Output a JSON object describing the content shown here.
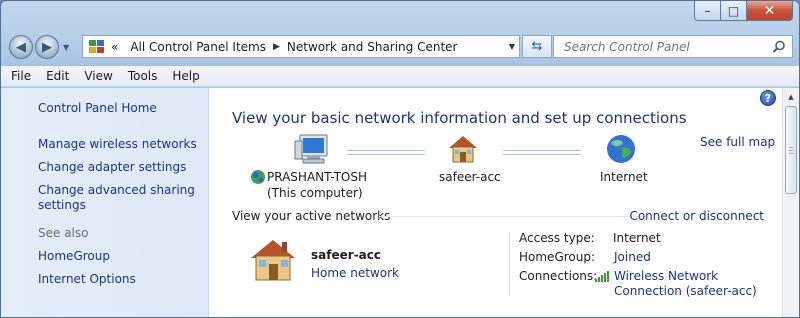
{
  "window": {
    "caption": {
      "minimize": "–",
      "maximize": "□",
      "close": "✕"
    }
  },
  "address_bar": {
    "chevron": "«",
    "crumbs": [
      "All Control Panel Items",
      "Network and Sharing Center"
    ]
  },
  "search": {
    "placeholder": "Search Control Panel"
  },
  "menu": [
    "File",
    "Edit",
    "View",
    "Tools",
    "Help"
  ],
  "left_pane": {
    "home": "Control Panel Home",
    "tasks": [
      "Manage wireless networks",
      "Change adapter settings",
      "Change advanced sharing settings"
    ],
    "see_also_label": "See also",
    "see_also": [
      "HomeGroup",
      "Internet Options"
    ]
  },
  "main": {
    "heading": "View your basic network information and set up connections",
    "see_full_map": "See full map",
    "map": {
      "computer_name": "PRASHANT-TOSH",
      "computer_sub": "(This computer)",
      "network": "safeer-acc",
      "internet": "Internet"
    },
    "active_networks_title": "View your active networks",
    "connect_disconnect": "Connect or disconnect",
    "active_network": {
      "name": "safeer-acc",
      "type": "Home network",
      "access_type_label": "Access type:",
      "access_type_value": "Internet",
      "homegroup_label": "HomeGroup:",
      "homegroup_value": "Joined",
      "connections_label": "Connections:",
      "connections_value": "Wireless Network Connection (safeer-acc)"
    }
  },
  "colors": {
    "link": "#1e3287",
    "heading": "#1e3287",
    "left_pane_bg": "#e4eef9"
  }
}
